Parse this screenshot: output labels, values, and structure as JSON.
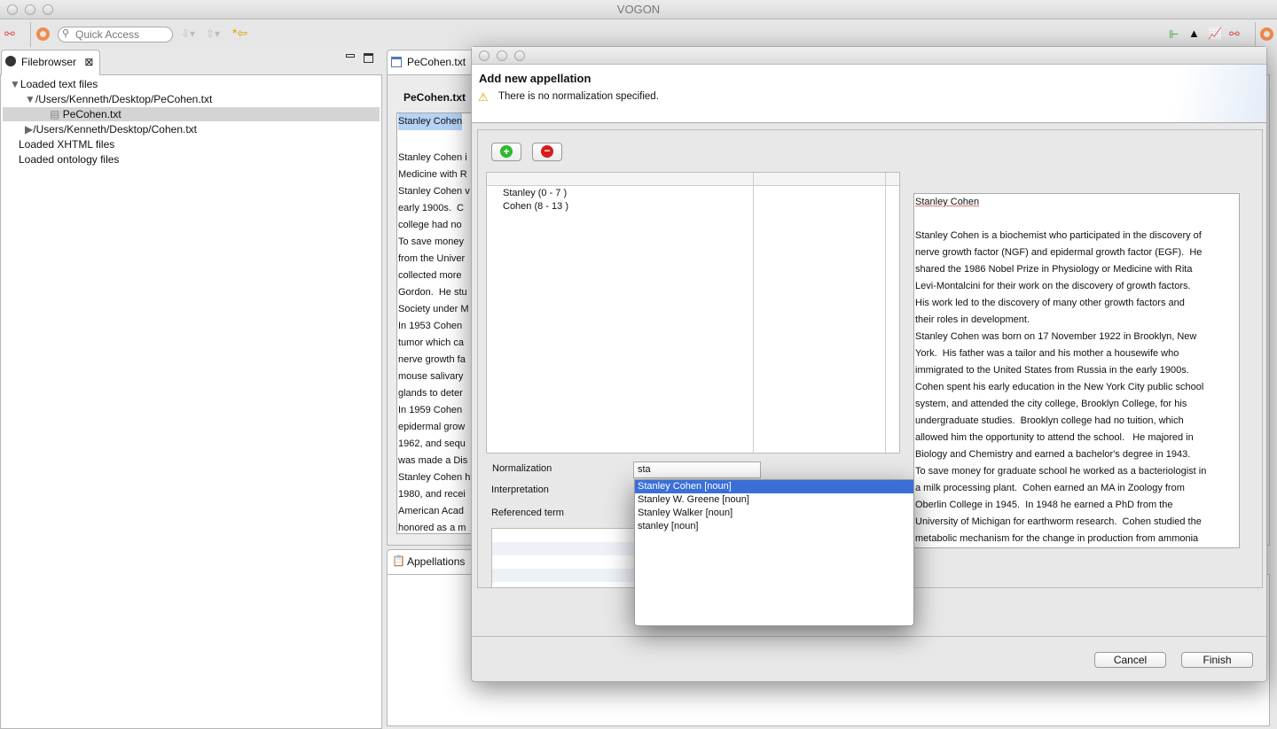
{
  "window": {
    "title": "VOGON"
  },
  "toolbar": {
    "quick_access_placeholder": "Quick Access"
  },
  "filebrowser": {
    "tab_label": "Filebrowser",
    "tree": [
      {
        "label": "Loaded text files",
        "expanded": true
      },
      {
        "label": "/Users/Kenneth/Desktop/PeCohen.txt",
        "expanded": true
      },
      {
        "label": "PeCohen.txt",
        "selected": true
      },
      {
        "label": "/Users/Kenneth/Desktop/Cohen.txt",
        "expanded": false
      },
      {
        "label": "Loaded XHTML files"
      },
      {
        "label": "Loaded ontology files"
      }
    ]
  },
  "editor": {
    "tab_label": "PeCohen.txt",
    "heading": "PeCohen.txt",
    "selected_text": "Stanley Cohen",
    "lines": [
      "",
      "Stanley Cohen i",
      "Medicine with R",
      "Stanley Cohen v",
      "early 1900s.  C",
      "college had no",
      "To save money",
      "from the Univer",
      "collected more",
      "Gordon.  He stu",
      "Society under M",
      "In 1953 Cohen",
      "tumor which ca",
      "nerve growth fa",
      "mouse salivary",
      "glands to deter",
      "In 1959 Cohen",
      "epidermal grow",
      "1962, and sequ",
      "was made a Dis",
      "Stanley Cohen h",
      "1980, and recei",
      "American Acad",
      "honored as a m"
    ]
  },
  "appellations": {
    "tab_label": "Appellations"
  },
  "dialog": {
    "title": "Add new appellation",
    "warning": "There is no normalization specified.",
    "table_rows": [
      "Stanley (0 - 7 )",
      "Cohen (8 - 13 )"
    ],
    "text_title": "Stanley Cohen",
    "text_lines": [
      "",
      "Stanley Cohen is a biochemist who participated in the discovery of",
      "nerve growth factor (NGF) and epidermal growth factor (EGF).  He",
      "shared the 1986 Nobel Prize in Physiology or Medicine with Rita",
      "Levi-Montalcini for their work on the discovery of growth factors.",
      "His work led to the discovery of many other growth factors and",
      "their roles in development.",
      "Stanley Cohen was born on 17 November 1922 in Brooklyn, New",
      "York.  His father was a tailor and his mother a housewife who",
      "immigrated to the United States from Russia in the early 1900s.",
      "Cohen spent his early education in the New York City public school",
      "system, and attended the city college, Brooklyn College, for his",
      "undergraduate studies.  Brooklyn college had no tuition, which",
      "allowed him the opportunity to attend the school.   He majored in",
      "Biology and Chemistry and earned a bachelor's degree in 1943.",
      "To save money for graduate school he worked as a bacteriologist in",
      "a milk processing plant.  Cohen earned an MA in Zoology from",
      "Oberlin College in 1945.  In 1948 he earned a PhD from the",
      "University of Michigan for earthworm research.  Cohen studied the",
      "metabolic mechanism for the change in production from ammonia"
    ],
    "normalization_label": "Normalization",
    "normalization_value": "sta",
    "interpretation_label": "Interpretation",
    "referenced_term_label": "Referenced term",
    "suggestions": [
      "Stanley Cohen [noun]",
      "Stanley W. Greene [noun]",
      "Stanley Walker [noun]",
      "stanley [noun]"
    ],
    "selected_suggestion": 0,
    "cancel_label": "Cancel",
    "finish_label": "Finish"
  },
  "colors": {
    "selection": "#3a6fd8",
    "text_highlight": "#b5d3f7",
    "add": "#2db92d",
    "remove": "#d81c1c"
  }
}
